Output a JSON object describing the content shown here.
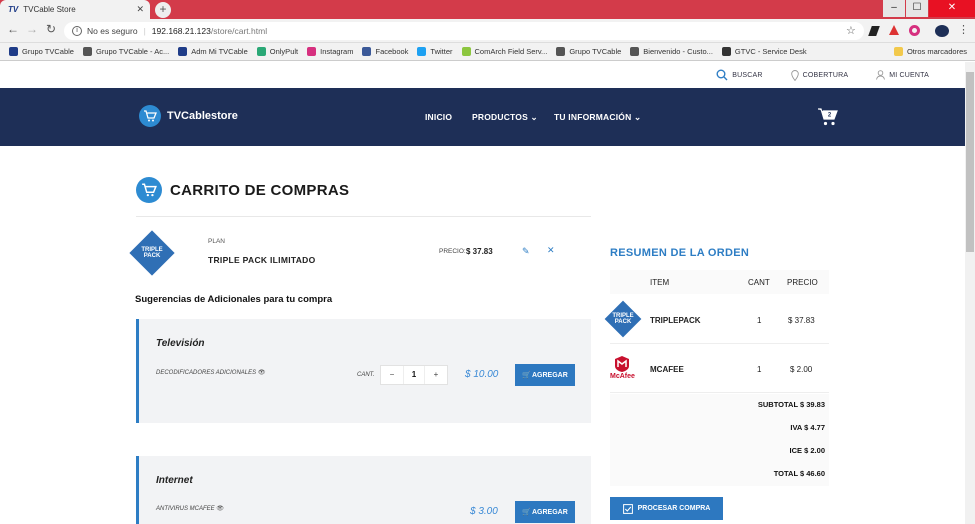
{
  "browser": {
    "tab_title": "TVCable Store",
    "tab_logo": "TV",
    "not_secure": "No es seguro",
    "url_host": "192.168.21.123",
    "url_path": "/store/cart.html",
    "bookmarks": [
      {
        "label": "Grupo TVCable",
        "color": "#1f3c88"
      },
      {
        "label": "Grupo TVCable - Ac...",
        "color": "#555555"
      },
      {
        "label": "Adm Mi TVCable",
        "color": "#1f3c88"
      },
      {
        "label": "OnlyPult",
        "color": "#2aa876"
      },
      {
        "label": "Instagram",
        "color": "#d6307f"
      },
      {
        "label": "Facebook",
        "color": "#3b5998"
      },
      {
        "label": "Twitter",
        "color": "#1da1f2"
      },
      {
        "label": "ComArch Field Serv...",
        "color": "#8cc63f"
      },
      {
        "label": "Grupo TVCable",
        "color": "#555555"
      },
      {
        "label": "Bienvenido - Custo...",
        "color": "#555555"
      },
      {
        "label": "GTVC - Service Desk",
        "color": "#333333"
      }
    ],
    "other_bookmarks": "Otros marcadores"
  },
  "site": {
    "util": {
      "search": "BUSCAR",
      "coverage": "COBERTURA",
      "account": "MI CUENTA"
    },
    "brand": "TVCablestore",
    "nav": {
      "home": "INICIO",
      "products": "PRODUCTOS",
      "info": "TU INFORMACIÓN"
    },
    "cart_count": "2"
  },
  "cart": {
    "title": "CARRITO DE COMPRAS",
    "plan_label": "PLAN",
    "plan_name": "TRIPLE PACK ILIMITADO",
    "plan_logo": "TRIPLE PACK",
    "price_label": "PRECIO:",
    "price_value": "$ 37.83",
    "suggestions_title": "Sugerencias de Adicionales para tu compra",
    "cards": [
      {
        "title": "Televisión",
        "addon": "DECODIFICADORES ADICIONALES",
        "qty_label": "CANT.",
        "qty": "1",
        "price": "$ 10.00",
        "button": "AGREGAR"
      },
      {
        "title": "Internet",
        "addon": "ANTIVIRUS MCAFEE",
        "price": "$ 3.00",
        "button": "AGREGAR"
      }
    ]
  },
  "summary": {
    "title": "RESUMEN DE LA ORDEN",
    "headers": {
      "item": "ITEM",
      "qty": "CANT",
      "price": "PRECIO"
    },
    "items": [
      {
        "name": "TRIPLEPACK",
        "logo": "TRIPLE PACK",
        "qty": "1",
        "price": "$ 37.83"
      },
      {
        "name": "MCAFEE",
        "logo": "McAfee",
        "qty": "1",
        "price": "$ 2.00"
      }
    ],
    "subtotal": "SUBTOTAL $ 39.83",
    "iva": "IVA $ 4.77",
    "ice": "ICE $ 2.00",
    "total": "TOTAL $ 46.60",
    "button": "PROCESAR COMPRA"
  }
}
